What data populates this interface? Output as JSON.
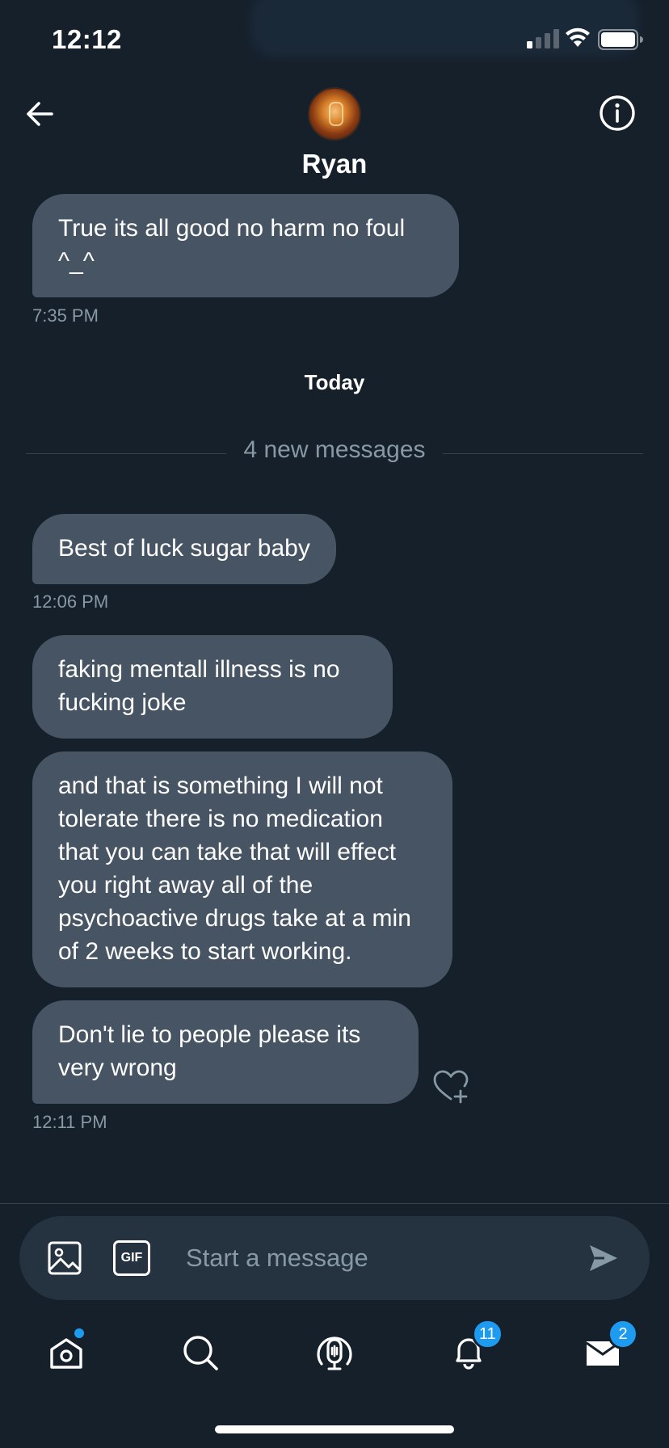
{
  "status_bar": {
    "time": "12:12"
  },
  "header": {
    "contact_name": "Ryan",
    "back_icon": "arrow-left-icon",
    "info_icon": "info-icon"
  },
  "conversation": {
    "earlier": [
      {
        "text": "True its all good no harm no foul ^_^",
        "time": "7:35 PM"
      }
    ],
    "day_label": "Today",
    "new_messages_label": "4 new messages",
    "messages": [
      {
        "text": "Best of luck sugar baby",
        "time": "12:06 PM"
      },
      {
        "text": "faking mentall illness is no fucking joke"
      },
      {
        "text": "and that is something I will not tolerate there is no medication that you can take that will effect you right away all of the psychoactive drugs take at a min of 2 weeks to start working."
      },
      {
        "text": "Don't lie to people please its very wrong",
        "time": "12:11 PM"
      }
    ]
  },
  "composer": {
    "placeholder": "Start a message",
    "gif_label": "GIF"
  },
  "nav": {
    "notifications_badge": "11",
    "messages_badge": "2"
  },
  "colors": {
    "background": "#15202b",
    "bubble": "#465463",
    "accent": "#1d9bf0",
    "muted_text": "#8899a6"
  }
}
